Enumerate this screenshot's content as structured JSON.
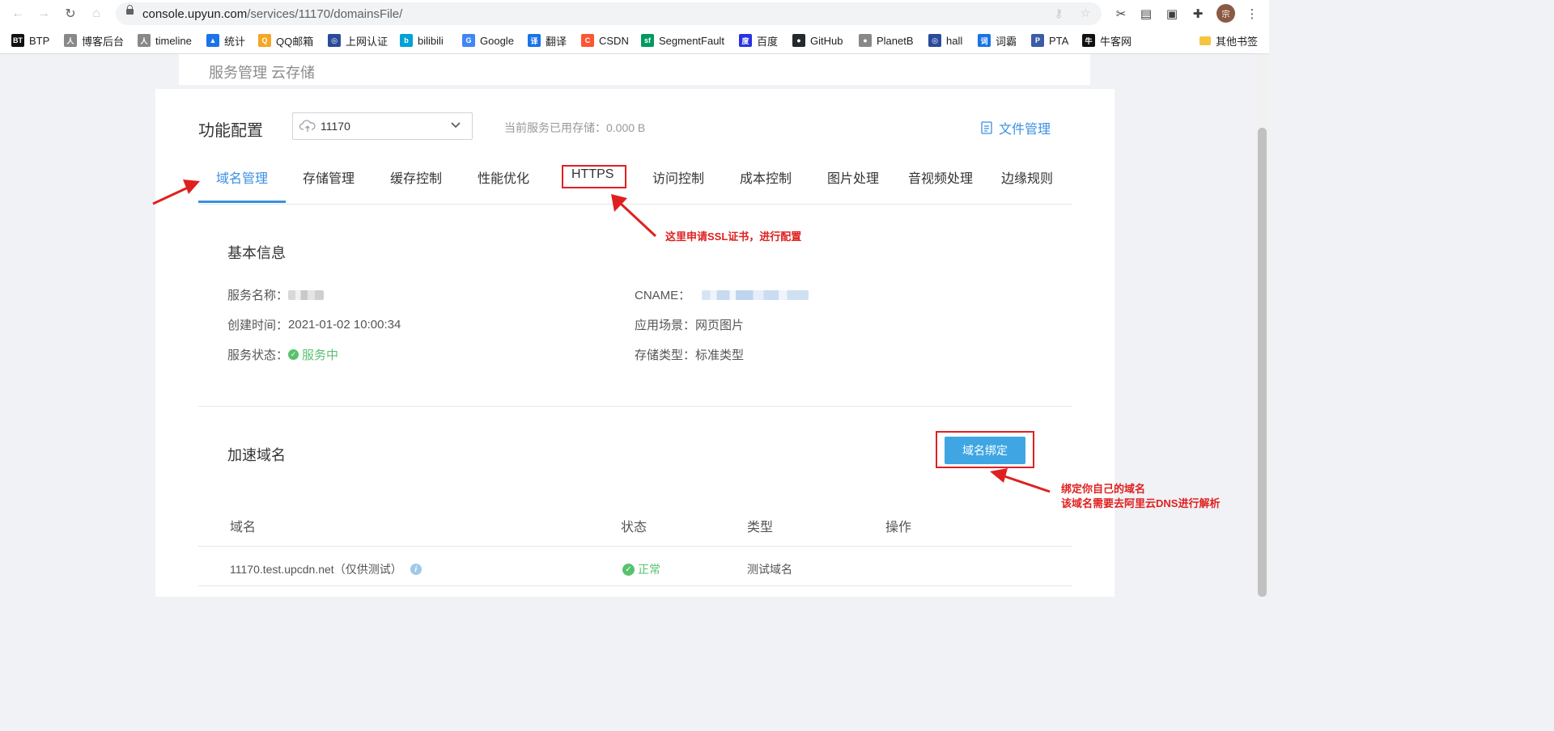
{
  "browser": {
    "url_host": "console.upyun.com",
    "url_path": "/services/11170/domainsFile/",
    "avatar_text": "宗",
    "bookmarks": [
      {
        "label": "BTP",
        "icon": "BT",
        "color": "#111111"
      },
      {
        "label": "博客后台",
        "icon": "人",
        "color": "#888888"
      },
      {
        "label": "timeline",
        "icon": "人",
        "color": "#888888"
      },
      {
        "label": "统计",
        "icon": "▲",
        "color": "#1a73e8"
      },
      {
        "label": "QQ邮箱",
        "icon": "Q",
        "color": "#f5a623"
      },
      {
        "label": "上网认证",
        "icon": "◎",
        "color": "#2a4a9a"
      },
      {
        "label": "bilibili",
        "icon": "b",
        "color": "#00a1d6"
      },
      {
        "label": "Google",
        "icon": "G",
        "color": "#4285f4"
      },
      {
        "label": "翻译",
        "icon": "译",
        "color": "#1a73e8"
      },
      {
        "label": "CSDN",
        "icon": "C",
        "color": "#fc5531"
      },
      {
        "label": "SegmentFault",
        "icon": "sf",
        "color": "#009a61"
      },
      {
        "label": "百度",
        "icon": "度",
        "color": "#2932e1"
      },
      {
        "label": "GitHub",
        "icon": "●",
        "color": "#24292e"
      },
      {
        "label": "PlanetB",
        "icon": "●",
        "color": "#888888"
      },
      {
        "label": "hall",
        "icon": "◎",
        "color": "#2a4a9a"
      },
      {
        "label": "词霸",
        "icon": "词",
        "color": "#1a73e8"
      },
      {
        "label": "PTA",
        "icon": "P",
        "color": "#3b5ba5"
      },
      {
        "label": "牛客网",
        "icon": "牛",
        "color": "#111111"
      }
    ],
    "other_bookmarks": "其他书签"
  },
  "page": {
    "breadcrumb": "服务管理 云存储",
    "func_title": "功能配置",
    "service_select": "11170",
    "usage_text": "当前服务已用存储：0.000 B",
    "file_manage": "文件管理",
    "tabs": [
      "域名管理",
      "存储管理",
      "缓存控制",
      "性能优化",
      "HTTPS",
      "访问控制",
      "成本控制",
      "图片处理",
      "音视频处理",
      "边缘规则"
    ],
    "basic": {
      "title": "基本信息",
      "service_name_label": "服务名称：",
      "created_label": "创建时间：",
      "created_value": "2021-01-02 10:00:34",
      "status_label": "服务状态：",
      "status_value": "服务中",
      "cname_label": "CNAME：",
      "scene_label": "应用场景：",
      "scene_value": "网页图片",
      "storage_label": "存储类型：",
      "storage_value": "标准类型"
    },
    "domains": {
      "title": "加速域名",
      "bind_button": "域名绑定",
      "headers": [
        "域名",
        "状态",
        "类型",
        "操作"
      ],
      "rows": [
        {
          "domain": "11170.test.upcdn.net（仅供测试）",
          "status": "正常",
          "type": "测试域名"
        }
      ]
    }
  },
  "annotations": {
    "https_note": "这里申请SSL证书，进行配置",
    "bind_note_1": "绑定你自己的域名",
    "bind_note_2": "该域名需要去阿里云DNS进行解析"
  },
  "colors": {
    "accent": "#3b8fe0",
    "button": "#3fa6e3",
    "success": "#57c26c",
    "annotation": "#e02020"
  }
}
